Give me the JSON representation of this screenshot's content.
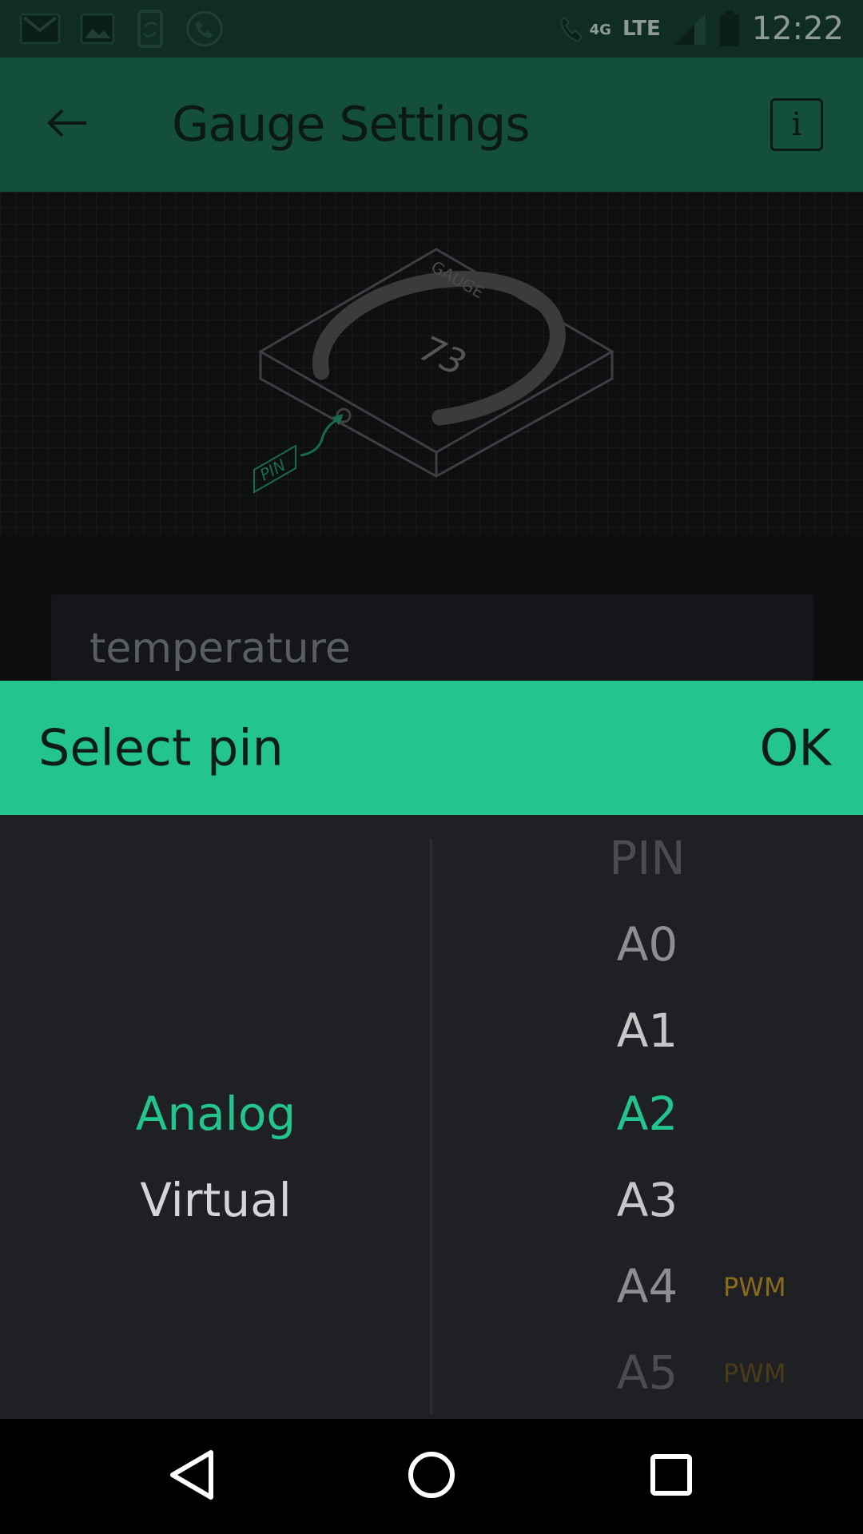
{
  "status_bar": {
    "network": "LTE",
    "network_small": "4G",
    "time": "12:22",
    "icons": [
      "gmail-icon",
      "image-icon",
      "phone-sync-icon",
      "call-icon",
      "wifi-call-icon",
      "signal-icon",
      "battery-icon"
    ]
  },
  "app_bar": {
    "title": "Gauge Settings",
    "back_icon": "arrow-left-icon",
    "info_label": "i"
  },
  "preview": {
    "widget_label": "GAUGE",
    "gauge_value": "73",
    "pin_label": "PIN"
  },
  "form": {
    "name_value": "temperature"
  },
  "dialog": {
    "title": "Select pin",
    "ok_label": "OK",
    "pin_types": [
      {
        "label": "Analog",
        "selected": true
      },
      {
        "label": "Virtual",
        "selected": false
      }
    ],
    "pins": [
      {
        "label": "PIN",
        "tag": ""
      },
      {
        "label": "A0",
        "tag": ""
      },
      {
        "label": "A1",
        "tag": ""
      },
      {
        "label": "A2",
        "tag": "",
        "selected": true
      },
      {
        "label": "A3",
        "tag": ""
      },
      {
        "label": "A4",
        "tag": "PWM"
      },
      {
        "label": "A5",
        "tag": "PWM"
      }
    ]
  },
  "colors": {
    "accent": "#23c48e",
    "app_bar": "#134f3a",
    "status_bar": "#0f2d22",
    "picker_bg": "#1e2024",
    "pwm_tag": "#8b6a1d"
  }
}
